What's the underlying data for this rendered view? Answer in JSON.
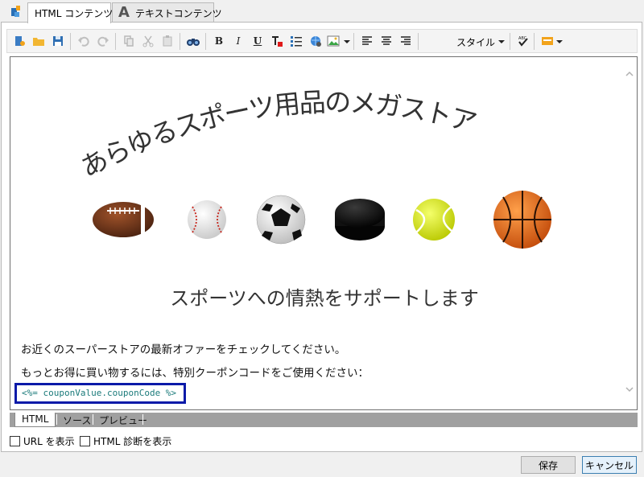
{
  "tabs": [
    {
      "label": "HTML コンテンツ",
      "active": true
    },
    {
      "label": "テキストコンテンツ",
      "active": false
    }
  ],
  "toolbar": {
    "bold": "B",
    "italic": "I",
    "underline": "U",
    "styles_label": "スタイル"
  },
  "content": {
    "headline": "あらゆるスポーツ用品のメガストア",
    "balls": [
      "football",
      "baseball",
      "soccer-ball",
      "hockey-puck",
      "tennis-ball",
      "basketball"
    ],
    "subtitle": "スポーツへの情熱をサポートします",
    "para1": "お近くのスーパーストアの最新オファーをチェックしてください。",
    "para2": "もっとお得に買い物するには、特別クーポンコードをご使用ください：",
    "code": "<%= couponValue.couponCode %>"
  },
  "mode_tabs": [
    "HTML",
    "ソース",
    "プレビュー"
  ],
  "options": {
    "show_url": "URL を表示",
    "show_diagnosis": "HTML 診断を表示"
  },
  "buttons": {
    "save": "保存",
    "cancel": "キャンセル"
  },
  "colors": {
    "highlight_border": "#0a1aa8",
    "code_text": "#1a7a7a"
  }
}
